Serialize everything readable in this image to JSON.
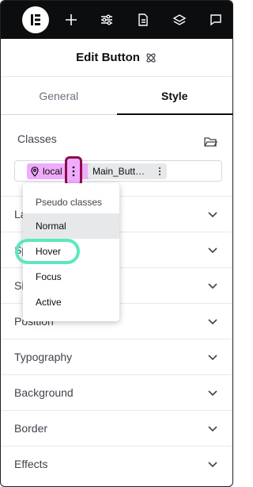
{
  "toolbar": {
    "logo_icon": "elementor-logo-icon",
    "icons": [
      "add-icon",
      "settings-sliders-icon",
      "page-icon",
      "layers-icon",
      "chat-icon"
    ]
  },
  "header": {
    "title": "Edit Button",
    "title_icon": "atomic-icon"
  },
  "tabs": [
    {
      "label": "General",
      "active": false
    },
    {
      "label": "Style",
      "active": true
    }
  ],
  "classes": {
    "label": "Classes",
    "local_chip": "local",
    "main_chip": "Main_Butt…"
  },
  "pseudo_menu": {
    "heading": "Pseudo classes",
    "items": [
      {
        "label": "Normal",
        "selected": true
      },
      {
        "label": "Hover",
        "selected": false
      },
      {
        "label": "Focus",
        "selected": false
      },
      {
        "label": "Active",
        "selected": false
      }
    ]
  },
  "sections": [
    {
      "label": "Layout"
    },
    {
      "label": "Spacing"
    },
    {
      "label": "Size"
    },
    {
      "label": "Position"
    },
    {
      "label": "Typography"
    },
    {
      "label": "Background"
    },
    {
      "label": "Border"
    },
    {
      "label": "Effects"
    }
  ],
  "colors": {
    "topbar": "#0c0d0e",
    "local_chip": "#f0abfc",
    "kebab_highlight": "#8e0e4a",
    "hover_highlight": "#5ee6c0"
  }
}
